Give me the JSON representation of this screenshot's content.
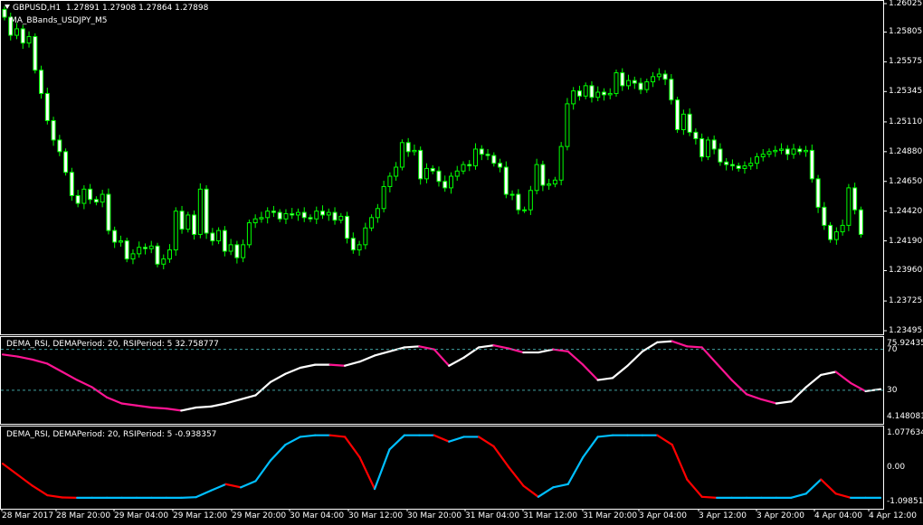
{
  "chart_header": {
    "symbol": "GBPUSD,H1",
    "ohlc": "1.27891 1.27908 1.27864 1.27898",
    "indicator": "MA_BBands_USDJPY_M5"
  },
  "colors": {
    "background": "#000000",
    "grid": "#ffffff",
    "bull_candle": "#00ff00",
    "bear_candle": "#ffffff",
    "level_line": "#40a0a0",
    "rsi_up": "#ffffff",
    "rsi_down": "#ff1493",
    "dema_up": "#00bfff",
    "dema_down": "#ff0000"
  },
  "main_chart": {
    "price_axis": [
      "1.26025",
      "1.25805",
      "1.25575",
      "1.25345",
      "1.25110",
      "1.24880",
      "1.24650",
      "1.24420",
      "1.24190",
      "1.23960",
      "1.23725",
      "1.23495"
    ]
  },
  "sub1": {
    "title": "DEMA_RSI, DEMAPeriod: 20, RSIPeriod: 5  32.758777",
    "axis": [
      "75.92435",
      "70",
      "30",
      "4.148081"
    ]
  },
  "sub2": {
    "title": "DEMA_RSI, DEMAPeriod: 20, RSIPeriod: 5  -0.938357",
    "axis": [
      "1.077634",
      "0.00",
      "-1.098516"
    ]
  },
  "time_axis": [
    "28 Mar 2017",
    "28 Mar 20:00",
    "29 Mar 04:00",
    "29 Mar 12:00",
    "29 Mar 20:00",
    "30 Mar 04:00",
    "30 Mar 12:00",
    "30 Mar 20:00",
    "31 Mar 04:00",
    "31 Mar 12:00",
    "31 Mar 20:00",
    "3 Apr 04:00",
    "3 Apr 12:00",
    "3 Apr 20:00",
    "4 Apr 04:00",
    "4 Apr 12:00"
  ],
  "chart_data": [
    {
      "type": "candlestick",
      "title": "GBPUSD,H1",
      "ylim": [
        1.23495,
        1.26025
      ],
      "ticks": [
        1.26025,
        1.25805,
        1.25575,
        1.25345,
        1.2511,
        1.2488,
        1.2465,
        1.2442,
        1.2419,
        1.2396,
        1.23725,
        1.23495
      ],
      "close": [
        1.2592,
        1.2578,
        1.2583,
        1.2572,
        1.2577,
        1.2551,
        1.2533,
        1.2512,
        1.2497,
        1.2488,
        1.2472,
        1.2454,
        1.2448,
        1.2459,
        1.2451,
        1.2449,
        1.2455,
        1.2427,
        1.2418,
        1.2419,
        1.2405,
        1.2409,
        1.2414,
        1.2413,
        1.2415,
        1.2401,
        1.2405,
        1.2412,
        1.2442,
        1.2428,
        1.2439,
        1.2424,
        1.2459,
        1.2425,
        1.2419,
        1.2427,
        1.2411,
        1.2416,
        1.2406,
        1.2416,
        1.2433,
        1.2436,
        1.2437,
        1.2442,
        1.2441,
        1.2436,
        1.244,
        1.2439,
        1.2441,
        1.2437,
        1.2436,
        1.2442,
        1.2439,
        1.2441,
        1.2435,
        1.2438,
        1.2421,
        1.2412,
        1.2416,
        1.2429,
        1.2437,
        1.2444,
        1.2461,
        1.2469,
        1.2476,
        1.2495,
        1.2488,
        1.2489,
        1.2467,
        1.2475,
        1.2473,
        1.2465,
        1.246,
        1.2469,
        1.2473,
        1.2478,
        1.2477,
        1.249,
        1.2486,
        1.2485,
        1.2479,
        1.2476,
        1.2455,
        1.2455,
        1.2443,
        1.2443,
        1.2458,
        1.2478,
        1.2462,
        1.2463,
        1.2466,
        1.2492,
        1.2525,
        1.2535,
        1.2531,
        1.2539,
        1.253,
        1.2534,
        1.2532,
        1.2533,
        1.2549,
        1.2539,
        1.2543,
        1.2541,
        1.2536,
        1.2542,
        1.2546,
        1.2548,
        1.2544,
        1.2528,
        1.2505,
        1.2517,
        1.2503,
        1.2498,
        1.2484,
        1.2497,
        1.249,
        1.248,
        1.2478,
        1.2477,
        1.2475,
        1.2477,
        1.2479,
        1.2484,
        1.2486,
        1.2488,
        1.2489,
        1.249,
        1.2486,
        1.249,
        1.2488,
        1.2489,
        1.2467,
        1.2445,
        1.2431,
        1.242,
        1.2426,
        1.2431,
        1.246,
        1.2443,
        1.2424
      ]
    },
    {
      "type": "line",
      "title": "DEMA_RSI, DEMAPeriod: 20, RSIPeriod: 5  32.758777",
      "ylim": [
        4.148081,
        75.92435
      ],
      "levels": [
        70,
        30
      ],
      "series": [
        {
          "values": [
            65,
            63,
            60,
            56,
            48,
            40,
            33,
            23,
            17,
            15,
            13,
            12,
            10,
            13,
            14,
            17,
            21,
            25,
            38,
            46,
            52,
            55,
            55,
            54,
            58,
            64,
            68,
            72,
            73,
            70,
            54,
            62,
            72,
            74,
            71,
            67,
            67,
            70,
            68,
            55,
            40,
            42,
            54,
            68,
            77,
            78,
            73,
            72,
            56,
            40,
            26,
            21,
            17,
            19,
            33,
            45,
            48,
            37,
            29,
            31
          ]
        }
      ]
    },
    {
      "type": "line",
      "title": "DEMA_RSI, DEMAPeriod: 20, RSIPeriod: 5  -0.938357",
      "ylim": [
        -1.098516,
        1.077634
      ],
      "series": [
        {
          "values": [
            0.1,
            -0.25,
            -0.6,
            -0.9,
            -0.97,
            -0.98,
            -0.98,
            -0.98,
            -0.98,
            -0.98,
            -0.98,
            -0.98,
            -0.98,
            -0.96,
            -0.75,
            -0.55,
            -0.65,
            -0.45,
            0.2,
            0.7,
            0.95,
            1.0,
            1.0,
            0.95,
            0.3,
            -0.7,
            0.55,
            1.0,
            1.0,
            1.0,
            0.8,
            0.95,
            0.95,
            0.65,
            0.0,
            -0.6,
            -0.95,
            -0.65,
            -0.55,
            0.3,
            0.95,
            1.0,
            1.0,
            1.0,
            1.0,
            0.7,
            -0.4,
            -0.95,
            -0.98,
            -0.98,
            -0.98,
            -0.98,
            -0.98,
            -0.98,
            -0.85,
            -0.4,
            -0.85,
            -0.98,
            -0.98,
            -0.98
          ]
        }
      ]
    }
  ]
}
